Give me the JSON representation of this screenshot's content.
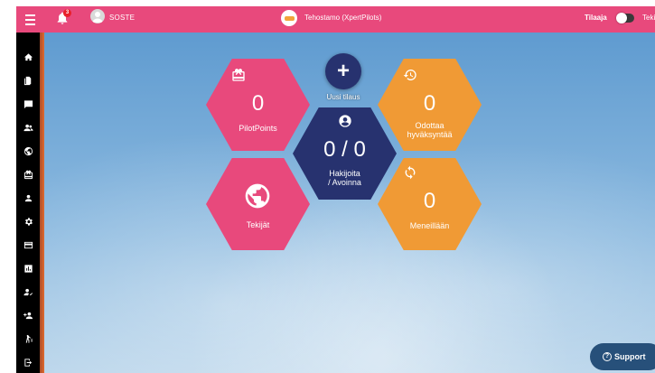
{
  "topbar": {
    "notification_count": "3",
    "user_name": "SOSTE",
    "org_name": "Tehostamo (XpertPilots)",
    "role_label": "Tilaaja",
    "role_label2": "Teki"
  },
  "dashboard": {
    "add_label": "Uusi tilaus",
    "pilotpoints": {
      "value": "0",
      "label": "PilotPoints"
    },
    "waiting": {
      "value": "0",
      "label_line1": "Odottaa",
      "label_line2": "hyväksyntää"
    },
    "applicants": {
      "value": "0 / 0",
      "label_line1": "Hakijoita",
      "label_line2": "/ Avoinna"
    },
    "makers": {
      "label": "Tekijät"
    },
    "ongoing": {
      "value": "0",
      "label": "Meneillään"
    }
  },
  "support": {
    "label": "Support"
  },
  "sidebar": {
    "icons": [
      "home-icon",
      "documents-icon",
      "chat-icon",
      "group-icon",
      "globe-icon",
      "gift-icon",
      "person-icon",
      "gear-icon",
      "card-icon",
      "chart-icon",
      "person-check-icon",
      "person-add-icon",
      "hiking-icon",
      "logout-icon"
    ]
  },
  "colors": {
    "pink": "#e8497c",
    "orange": "#f09a35",
    "navy": "#27326f"
  }
}
